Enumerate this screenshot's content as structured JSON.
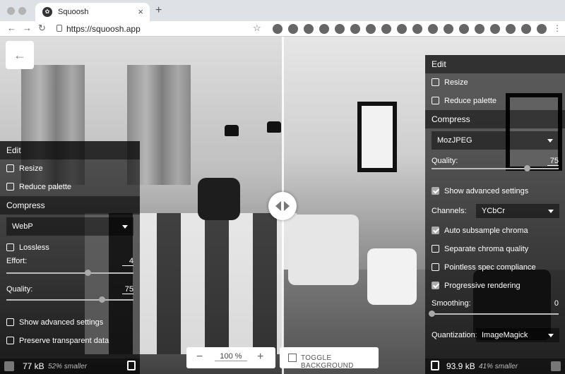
{
  "browser": {
    "tab_title": "Squoosh",
    "favicon_glyph": "✿",
    "tab_close": "×",
    "new_tab": "+",
    "back": "←",
    "forward": "→",
    "reload": "↻",
    "url": "https://squoosh.app",
    "bookmark": "☆"
  },
  "viewer": {
    "back_glyph": "←",
    "zoom_minus": "−",
    "zoom_value": "100 %",
    "zoom_plus": "+",
    "toggle_background": "TOGGLE BACKGROUND"
  },
  "left_panel": {
    "edit_heading": "Edit",
    "resize": "Resize",
    "reduce_palette": "Reduce palette",
    "compress_heading": "Compress",
    "codec": "WebP",
    "lossless": "Lossless",
    "effort_label": "Effort:",
    "effort_value": "4",
    "effort_fraction": 0.64,
    "quality_label": "Quality:",
    "quality_value": "75",
    "quality_fraction": 0.75,
    "show_advanced": "Show advanced settings",
    "preserve_transparent": "Preserve transparent data",
    "size": "77 kB",
    "savings": "52% smaller"
  },
  "right_panel": {
    "edit_heading": "Edit",
    "resize": "Resize",
    "reduce_palette": "Reduce palette",
    "compress_heading": "Compress",
    "codec": "MozJPEG",
    "quality_label": "Quality:",
    "quality_value": "75",
    "quality_fraction": 0.75,
    "show_advanced": "Show advanced settings",
    "channels_label": "Channels:",
    "channels_value": "YCbCr",
    "auto_subsample": "Auto subsample chroma",
    "separate_chroma": "Separate chroma quality",
    "pointless_spec": "Pointless spec compliance",
    "progressive": "Progressive rendering",
    "smoothing_label": "Smoothing:",
    "smoothing_value": "0",
    "smoothing_fraction": 0,
    "quantization_label": "Quantization:",
    "quantization_value": "ImageMagick",
    "size": "93.9 kB",
    "savings": "41% smaller"
  }
}
